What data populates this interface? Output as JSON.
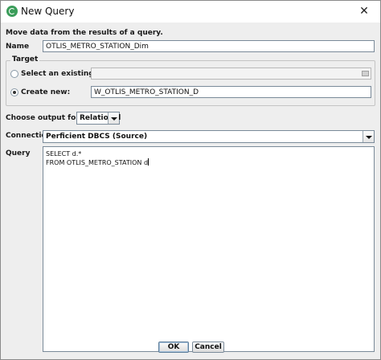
{
  "window": {
    "title": "New Query",
    "close_glyph": "✕"
  },
  "description": "Move data from the results of a query.",
  "name": {
    "label": "Name",
    "value": "OTLIS_METRO_STATION_Dim"
  },
  "target": {
    "title": "Target",
    "select_existing_label": "Select an existing:",
    "select_existing_value": "",
    "create_new_label": "Create new:",
    "create_new_value": "W_OTLIS_METRO_STATION_D",
    "selected": "create_new"
  },
  "output_format": {
    "label": "Choose output format:",
    "value": "Relational"
  },
  "connection": {
    "label": "Connection:",
    "value": "Perficient DBCS (Source)"
  },
  "query": {
    "label": "Query",
    "line1": "SELECT d.*",
    "line2": "FROM OTLIS_METRO_STATION d"
  },
  "buttons": {
    "ok": "OK",
    "cancel": "Cancel"
  }
}
